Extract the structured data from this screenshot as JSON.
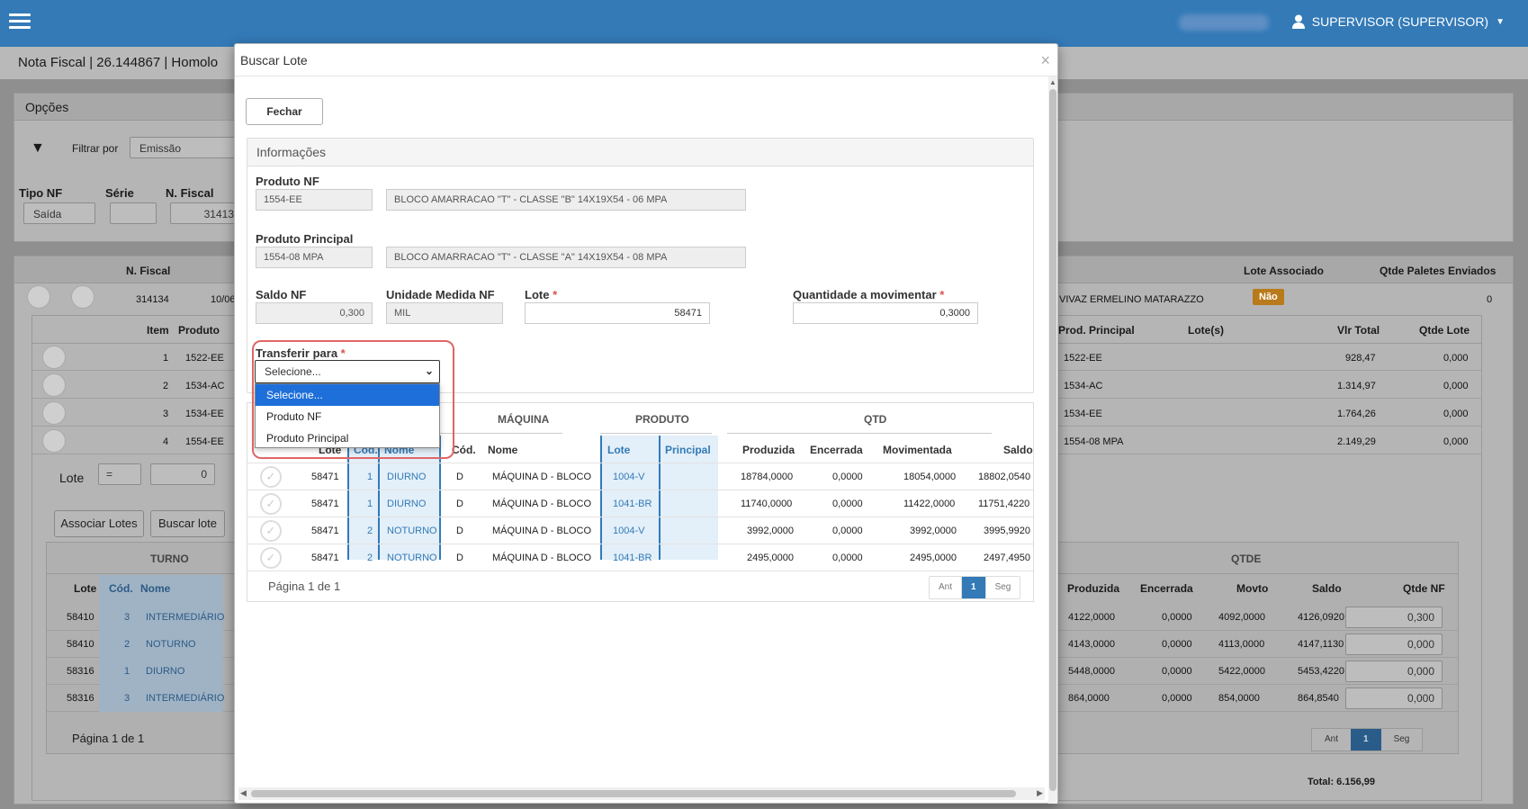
{
  "header": {
    "user_label": "SUPERVISOR (SUPERVISOR)"
  },
  "page": {
    "nf_title": "Nota Fiscal | 26.144867 | Homolo"
  },
  "options": {
    "title": "Opções",
    "filter_label": "Filtrar por",
    "filter_value": "Emissão",
    "tipo_nf_label": "Tipo NF",
    "tipo_nf_value": "Saída",
    "serie_label": "Série",
    "nfiscal_label": "N. Fiscal",
    "nfiscal_value": "31413"
  },
  "main_table": {
    "col_nfiscal": "N. Fiscal",
    "col_lote_assoc": "Lote Associado",
    "col_qtde_paletes": "Qtde Paletes Enviados",
    "row": {
      "nfiscal": "314134",
      "date": "10/06",
      "client": "VIVAZ ERMELINO MATARAZZO",
      "lote_assoc": "Não",
      "paletes": "0"
    }
  },
  "items_table": {
    "col_item": "Item",
    "col_produto": "Produto",
    "col_prod_principal": "Prod. Principal",
    "col_lotes": "Lote(s)",
    "col_vlr_total": "Vlr Total",
    "col_qtde_lote": "Qtde Lote",
    "rows": [
      {
        "item": "1",
        "produto": "1522-EE",
        "principal": "1522-EE",
        "vlr": "928,47",
        "qtde": "0,000"
      },
      {
        "item": "2",
        "produto": "1534-AC",
        "principal": "1534-AC",
        "vlr": "1.314,97",
        "qtde": "0,000"
      },
      {
        "item": "3",
        "produto": "1534-EE",
        "principal": "1534-EE",
        "vlr": "1.764,26",
        "qtde": "0,000"
      },
      {
        "item": "4",
        "produto": "1554-EE",
        "principal": "1554-08 MPA",
        "vlr": "2.149,29",
        "qtde": "0,000"
      }
    ],
    "lote_label": "Lote",
    "lote_op": "=",
    "lote_value": "0",
    "btn_associar": "Associar Lotes",
    "btn_buscar": "Buscar lote",
    "total": "Total: 6.156,99"
  },
  "lotes_table": {
    "group_turno": "TURNO",
    "group_qtde": "QTDE",
    "col_lote": "Lote",
    "col_cod": "Cód.",
    "col_nome": "Nome",
    "col_produzida": "Produzida",
    "col_encerrada": "Encerrada",
    "col_movto": "Movto",
    "col_saldo": "Saldo",
    "col_qtde_nf": "Qtde NF",
    "rows": [
      {
        "lote": "58410",
        "cod": "3",
        "nome": "INTERMEDIÁRIO",
        "produzida": "4122,0000",
        "encerrada": "0,0000",
        "movto": "4092,0000",
        "saldo": "4126,0920",
        "qtde_nf": "0,300"
      },
      {
        "lote": "58410",
        "cod": "2",
        "nome": "NOTURNO",
        "produzida": "4143,0000",
        "encerrada": "0,0000",
        "movto": "4113,0000",
        "saldo": "4147,1130",
        "qtde_nf": "0,000"
      },
      {
        "lote": "58316",
        "cod": "1",
        "nome": "DIURNO",
        "produzida": "5448,0000",
        "encerrada": "0,0000",
        "movto": "5422,0000",
        "saldo": "5453,4220",
        "qtde_nf": "0,000"
      },
      {
        "lote": "58316",
        "cod": "3",
        "nome": "INTERMEDIÁRIO",
        "produzida": "864,0000",
        "encerrada": "0,0000",
        "movto": "854,0000",
        "saldo": "864,8540",
        "qtde_nf": "0,000"
      }
    ],
    "pagination": "Página 1 de 1",
    "pager": {
      "prev": "Ant",
      "current": "1",
      "next": "Seg"
    }
  },
  "modal": {
    "title": "Buscar Lote",
    "close": "×",
    "btn_fechar": "Fechar",
    "info_title": "Informações",
    "produto_nf_label": "Produto NF",
    "produto_nf_code": "1554-EE",
    "produto_nf_desc": "BLOCO AMARRACAO \"T\" - CLASSE \"B\" 14X19X54 - 06 MPA",
    "produto_principal_label": "Produto Principal",
    "produto_principal_code": "1554-08 MPA",
    "produto_principal_desc": "BLOCO AMARRACAO \"T\" - CLASSE \"A\" 14X19X54 - 08 MPA",
    "saldo_nf_label": "Saldo NF",
    "saldo_nf_value": "0,300",
    "unidade_label": "Unidade Medida NF",
    "unidade_value": "MIL",
    "lote_label": "Lote",
    "lote_value": "58471",
    "qtd_mov_label": "Quantidade a movimentar",
    "qtd_mov_value": "0,3000",
    "required_mark": "*",
    "transferir_label": "Transferir para",
    "transferir_selected": "Selecione...",
    "transferir_options": [
      "Selecione...",
      "Produto NF",
      "Produto Principal"
    ],
    "grid": {
      "group_maquina": "MÁQUINA",
      "group_produto": "PRODUTO",
      "group_qtd": "QTD",
      "col_lote": "Lote",
      "col_cod": "Cód.",
      "col_nome": "Nome",
      "col_maq_cod": "Cód.",
      "col_maq_nome": "Nome",
      "col_prod_lote": "Lote",
      "col_prod_principal": "Principal",
      "col_produzida": "Produzida",
      "col_encerrada": "Encerrada",
      "col_movimentada": "Movimentada",
      "col_saldo": "Saldo",
      "rows": [
        {
          "lote": "58471",
          "cod": "1",
          "nome": "DIURNO",
          "maq_cod": "D",
          "maq_nome": "MÁQUINA D - BLOCO",
          "prod_lote": "1004-V",
          "principal": "",
          "produzida": "18784,0000",
          "encerrada": "0,0000",
          "movimentada": "18054,0000",
          "saldo": "18802,0540"
        },
        {
          "lote": "58471",
          "cod": "1",
          "nome": "DIURNO",
          "maq_cod": "D",
          "maq_nome": "MÁQUINA D - BLOCO",
          "prod_lote": "1041-BR",
          "principal": "",
          "produzida": "11740,0000",
          "encerrada": "0,0000",
          "movimentada": "11422,0000",
          "saldo": "11751,4220"
        },
        {
          "lote": "58471",
          "cod": "2",
          "nome": "NOTURNO",
          "maq_cod": "D",
          "maq_nome": "MÁQUINA D - BLOCO",
          "prod_lote": "1004-V",
          "principal": "",
          "produzida": "3992,0000",
          "encerrada": "0,0000",
          "movimentada": "3992,0000",
          "saldo": "3995,9920"
        },
        {
          "lote": "58471",
          "cod": "2",
          "nome": "NOTURNO",
          "maq_cod": "D",
          "maq_nome": "MÁQUINA D - BLOCO",
          "prod_lote": "1041-BR",
          "principal": "",
          "produzida": "2495,0000",
          "encerrada": "0,0000",
          "movimentada": "2495,0000",
          "saldo": "2497,4950"
        }
      ],
      "pagination": "Página 1 de 1",
      "pager": {
        "prev": "Ant",
        "current": "1",
        "next": "Seg"
      }
    }
  }
}
